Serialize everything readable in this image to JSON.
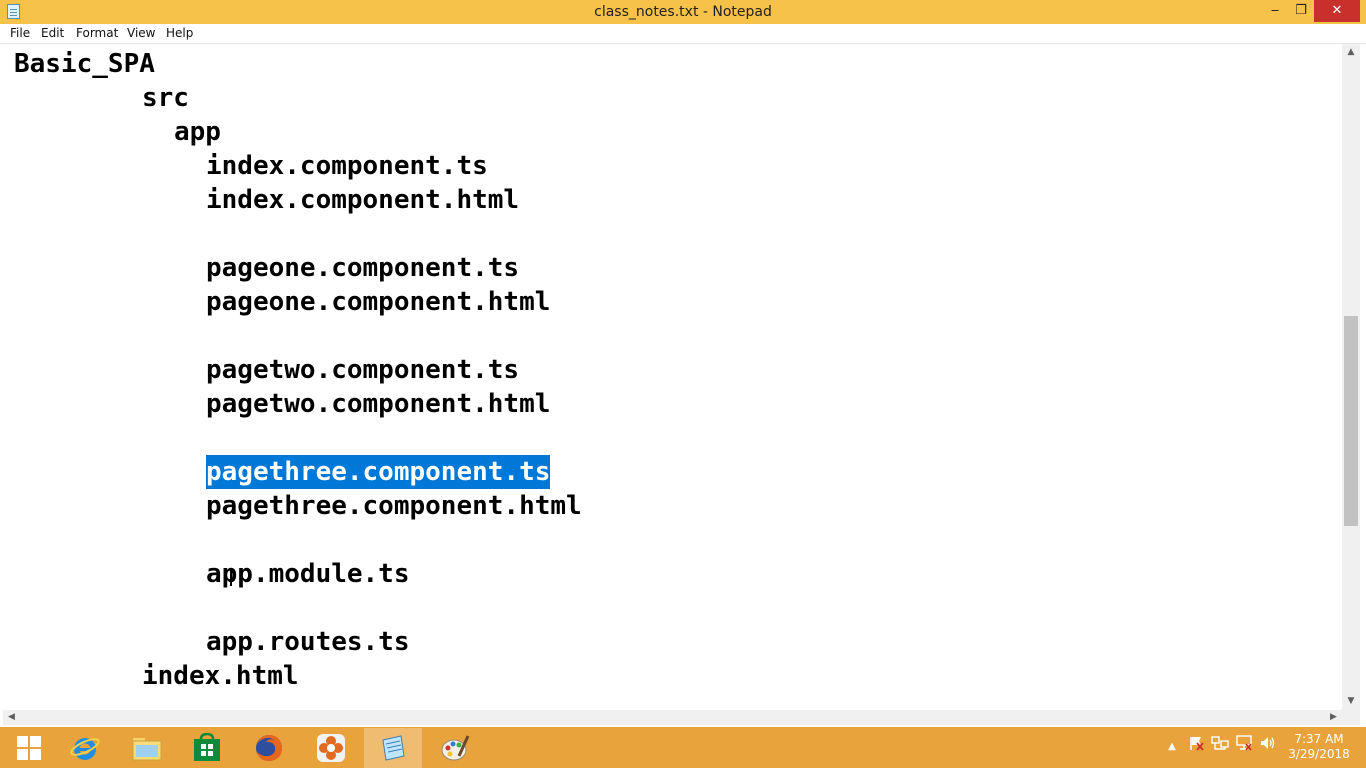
{
  "window": {
    "title": "class_notes.txt - Notepad",
    "minimize_glyph": "‒",
    "maximize_glyph": "❐",
    "close_glyph": "✕"
  },
  "menu": [
    "File",
    "Edit",
    "Format",
    "View",
    "Help"
  ],
  "document": {
    "lines": [
      "Basic_SPA",
      "src",
      "app",
      "index.component.ts",
      "index.component.html",
      "pageone.component.ts",
      "pageone.component.html",
      "pagetwo.component.ts",
      "pagetwo.component.html",
      "pagethree.component.ts",
      "pagethree.component.html",
      "app.module.ts",
      "app.routes.ts",
      "index.html"
    ],
    "selected_text": "pagethree.component.ts"
  },
  "scrollbars": {
    "vertical": {
      "up_glyph": "▲",
      "down_glyph": "▼"
    },
    "horizontal": {
      "left_glyph": "◀",
      "right_glyph": "▶"
    }
  },
  "taskbar": {
    "apps": [
      "windows-start",
      "internet-explorer",
      "file-explorer",
      "store",
      "firefox",
      "app-flower",
      "notepad",
      "paint"
    ],
    "tray": {
      "show_hidden_glyph": "▲"
    },
    "clock": {
      "time": "7:37 AM",
      "date": "3/29/2018"
    }
  },
  "colors": {
    "titlebar": "#f7c24a",
    "taskbar": "#e9a33c",
    "selection": "#0078d7",
    "close": "#c7302b"
  }
}
